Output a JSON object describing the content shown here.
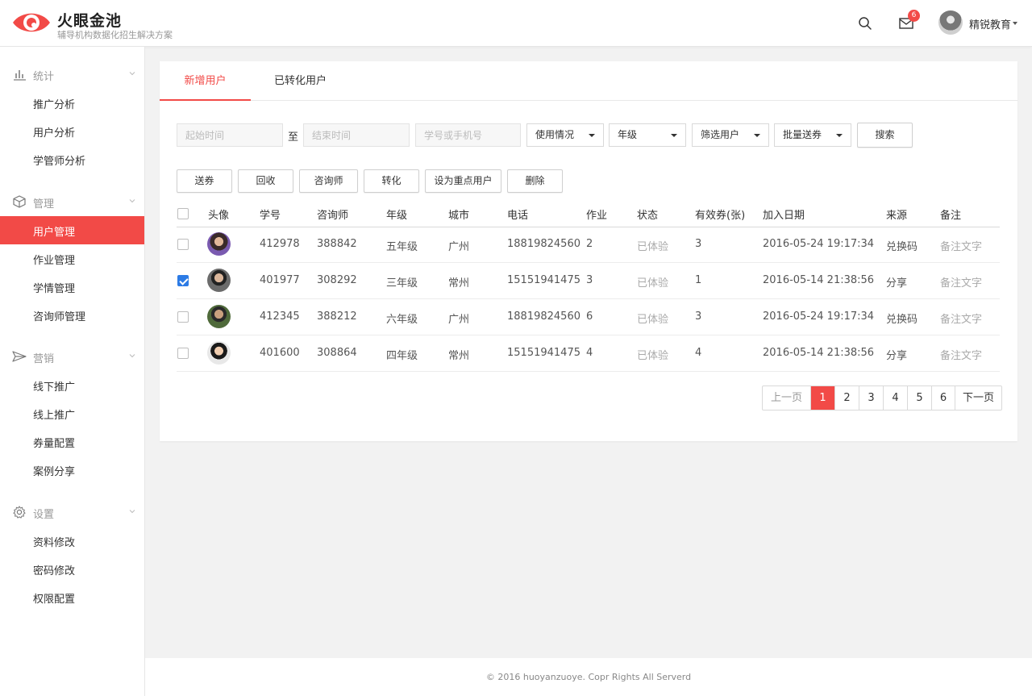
{
  "app": {
    "title": "火眼金池",
    "subtitle": "辅导机构数据化招生解决方案"
  },
  "header": {
    "mail_count": "6",
    "user_name": "精锐教育",
    "icons": [
      "search-icon",
      "mail-icon",
      "avatar"
    ]
  },
  "colors": {
    "accent": "#f24a47",
    "checkbox": "#2c7be5"
  },
  "sidebar": {
    "groups": [
      {
        "label": "统计",
        "icon": "bar-chart-icon",
        "items": [
          "推广分析",
          "用户分析",
          "学管师分析"
        ]
      },
      {
        "label": "管理",
        "icon": "cube-icon",
        "items": [
          "用户管理",
          "作业管理",
          "学情管理",
          "咨询师管理"
        ]
      },
      {
        "label": "营销",
        "icon": "send-icon",
        "items": [
          "线下推广",
          "线上推广",
          "券量配置",
          "案例分享"
        ]
      },
      {
        "label": "设置",
        "icon": "gear-icon",
        "items": [
          "资料修改",
          "密码修改",
          "权限配置"
        ]
      }
    ],
    "active_item": "用户管理"
  },
  "tabs": [
    "新增用户",
    "已转化用户"
  ],
  "filters": {
    "start_placeholder": "起始时间",
    "to_label": "至",
    "end_placeholder": "结束时间",
    "search_placeholder": "学号或手机号",
    "selects": [
      "使用情况",
      "年级",
      "筛选用户",
      "批量送券"
    ],
    "search_button": "搜索"
  },
  "actions": [
    "送券",
    "回收",
    "咨询师",
    "转化",
    "设为重点用户",
    "删除"
  ],
  "table": {
    "columns": [
      "头像",
      "学号",
      "咨询师",
      "年级",
      "城市",
      "电话",
      "作业",
      "状态",
      "有效券(张)",
      "加入日期",
      "来源",
      "备注"
    ],
    "rows": [
      {
        "checked": false,
        "student_id": "412978",
        "counselor": "388842",
        "grade": "五年级",
        "city": "广州",
        "phone": "18819824560",
        "homework": "2",
        "status": "已体验",
        "coupons": "3",
        "date": "2016-05-24 19:17:34",
        "source": "兑换码",
        "note": "备注文字"
      },
      {
        "checked": true,
        "student_id": "401977",
        "counselor": "308292",
        "grade": "三年级",
        "city": "常州",
        "phone": "15151941475",
        "homework": "3",
        "status": "已体验",
        "coupons": "1",
        "date": "2016-05-14 21:38:56",
        "source": "分享",
        "note": "备注文字"
      },
      {
        "checked": false,
        "student_id": "412345",
        "counselor": "388212",
        "grade": "六年级",
        "city": "广州",
        "phone": "18819824560",
        "homework": "6",
        "status": "已体验",
        "coupons": "3",
        "date": "2016-05-24 19:17:34",
        "source": "兑换码",
        "note": "备注文字"
      },
      {
        "checked": false,
        "student_id": "401600",
        "counselor": "308864",
        "grade": "四年级",
        "city": "常州",
        "phone": "15151941475",
        "homework": "4",
        "status": "已体验",
        "coupons": "4",
        "date": "2016-05-14 21:38:56",
        "source": "分享",
        "note": "备注文字"
      }
    ]
  },
  "pagination": {
    "prev": "上一页",
    "pages": [
      "1",
      "2",
      "3",
      "4",
      "5",
      "6"
    ],
    "current": "1",
    "next": "下一页"
  },
  "footer": {
    "text": "© 2016 huoyanzuoye. Copr Rights All Serverd"
  }
}
